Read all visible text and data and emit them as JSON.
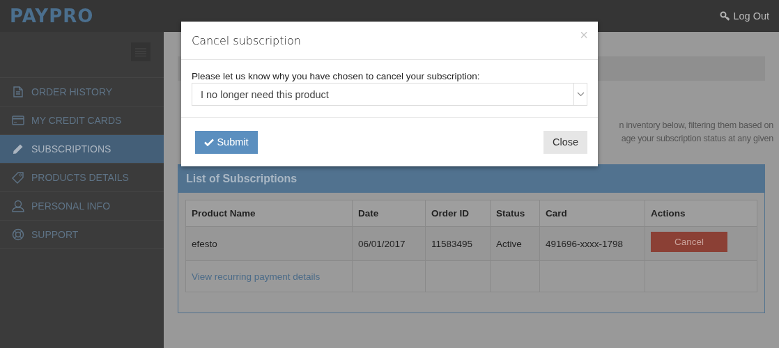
{
  "header": {
    "logo": "PAYPRO",
    "logout": "Log Out"
  },
  "sidebar": {
    "items": [
      {
        "label": "ORDER HISTORY",
        "selected": false
      },
      {
        "label": "MY CREDIT CARDS",
        "selected": false
      },
      {
        "label": "SUBSCRIPTIONS",
        "selected": true
      },
      {
        "label": "PRODUCTS DETAILS",
        "selected": false
      },
      {
        "label": "PERSONAL INFO",
        "selected": false
      },
      {
        "label": "SUPPORT",
        "selected": false
      }
    ]
  },
  "page": {
    "lines": [
      "n inventory below, filtering them based on",
      "age your subscription status at any given"
    ]
  },
  "panel": {
    "title": "List of Subscriptions",
    "table": {
      "columns": [
        "Product Name",
        "Date",
        "Order ID",
        "Status",
        "Card",
        "Actions"
      ],
      "rows": [
        {
          "cells": [
            "efesto",
            "06/01/2017",
            "11583495",
            "Active",
            "491696-xxxx-1798"
          ],
          "action": "Cancel"
        },
        {
          "link": "View recurring payment details"
        }
      ]
    }
  },
  "modal": {
    "title": "Cancel subscription",
    "close_icon": "×",
    "label": "Please let us know why you have chosen to cancel your subscription:",
    "select_value": "I no longer need this product",
    "submit": "Submit",
    "close": "Close"
  }
}
